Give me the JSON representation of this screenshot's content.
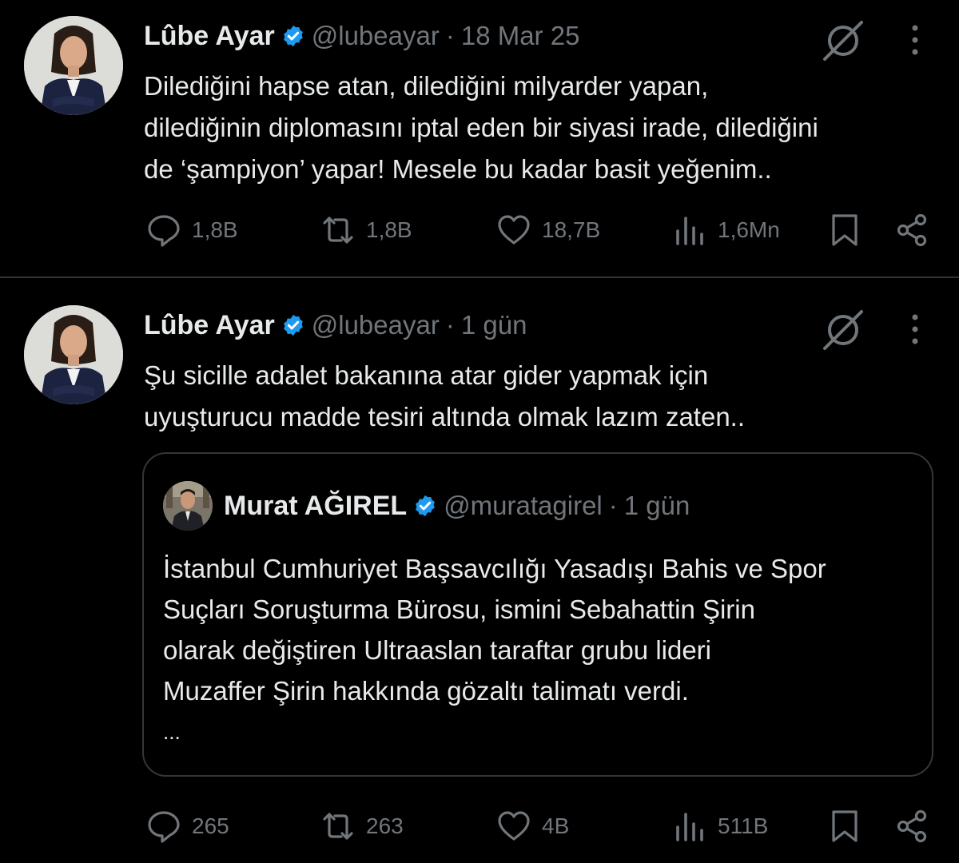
{
  "tweets": [
    {
      "author_name": "Lûbe Ayar",
      "handle": "@lubeayar",
      "separator": "·",
      "time": "18 Mar 25",
      "text_lines": [
        "Dilediğini hapse atan, dilediğini milyarder yapan,",
        "dilediğinin diplomasını iptal eden bir siyasi irade, dilediğini",
        "de ‘şampiyon’ yapar! Mesele bu kadar basit yeğenim.."
      ],
      "stats": {
        "replies": "1,8B",
        "reposts": "1,8B",
        "likes": "18,7B",
        "views": "1,6Mn"
      }
    },
    {
      "author_name": "Lûbe Ayar",
      "handle": "@lubeayar",
      "separator": "·",
      "time": "1 gün",
      "text_lines": [
        "Şu sicille adalet bakanına atar gider yapmak için",
        "uyuşturucu madde tesiri altında olmak lazım zaten.."
      ],
      "quoted": {
        "author_name": "Murat AĞIREL",
        "handle": "@muratagirel",
        "separator": "·",
        "time": "1 gün",
        "text_lines": [
          "İstanbul Cumhuriyet Başsavcılığı Yasadışı Bahis ve Spor",
          "Suçları Soruşturma Bürosu, ismini Sebahattin Şirin",
          "olarak değiştiren Ultraaslan taraftar grubu lideri",
          "Muzaffer Şirin hakkında gözaltı talimatı verdi.",
          "..."
        ]
      },
      "stats": {
        "replies": "265",
        "reposts": "263",
        "likes": "4B",
        "views": "511B"
      }
    }
  ],
  "icons": {
    "verified": "verified-badge-icon",
    "grok": "grok-icon",
    "more": "more-options-icon",
    "reply": "reply-icon",
    "repost": "repost-icon",
    "like": "like-icon",
    "views": "views-icon",
    "bookmark": "bookmark-icon",
    "share": "share-icon"
  },
  "colors": {
    "background": "#000000",
    "text": "#e7e9ea",
    "secondary": "#71767b",
    "verified": "#1d9bf0",
    "border": "#2f3336"
  }
}
